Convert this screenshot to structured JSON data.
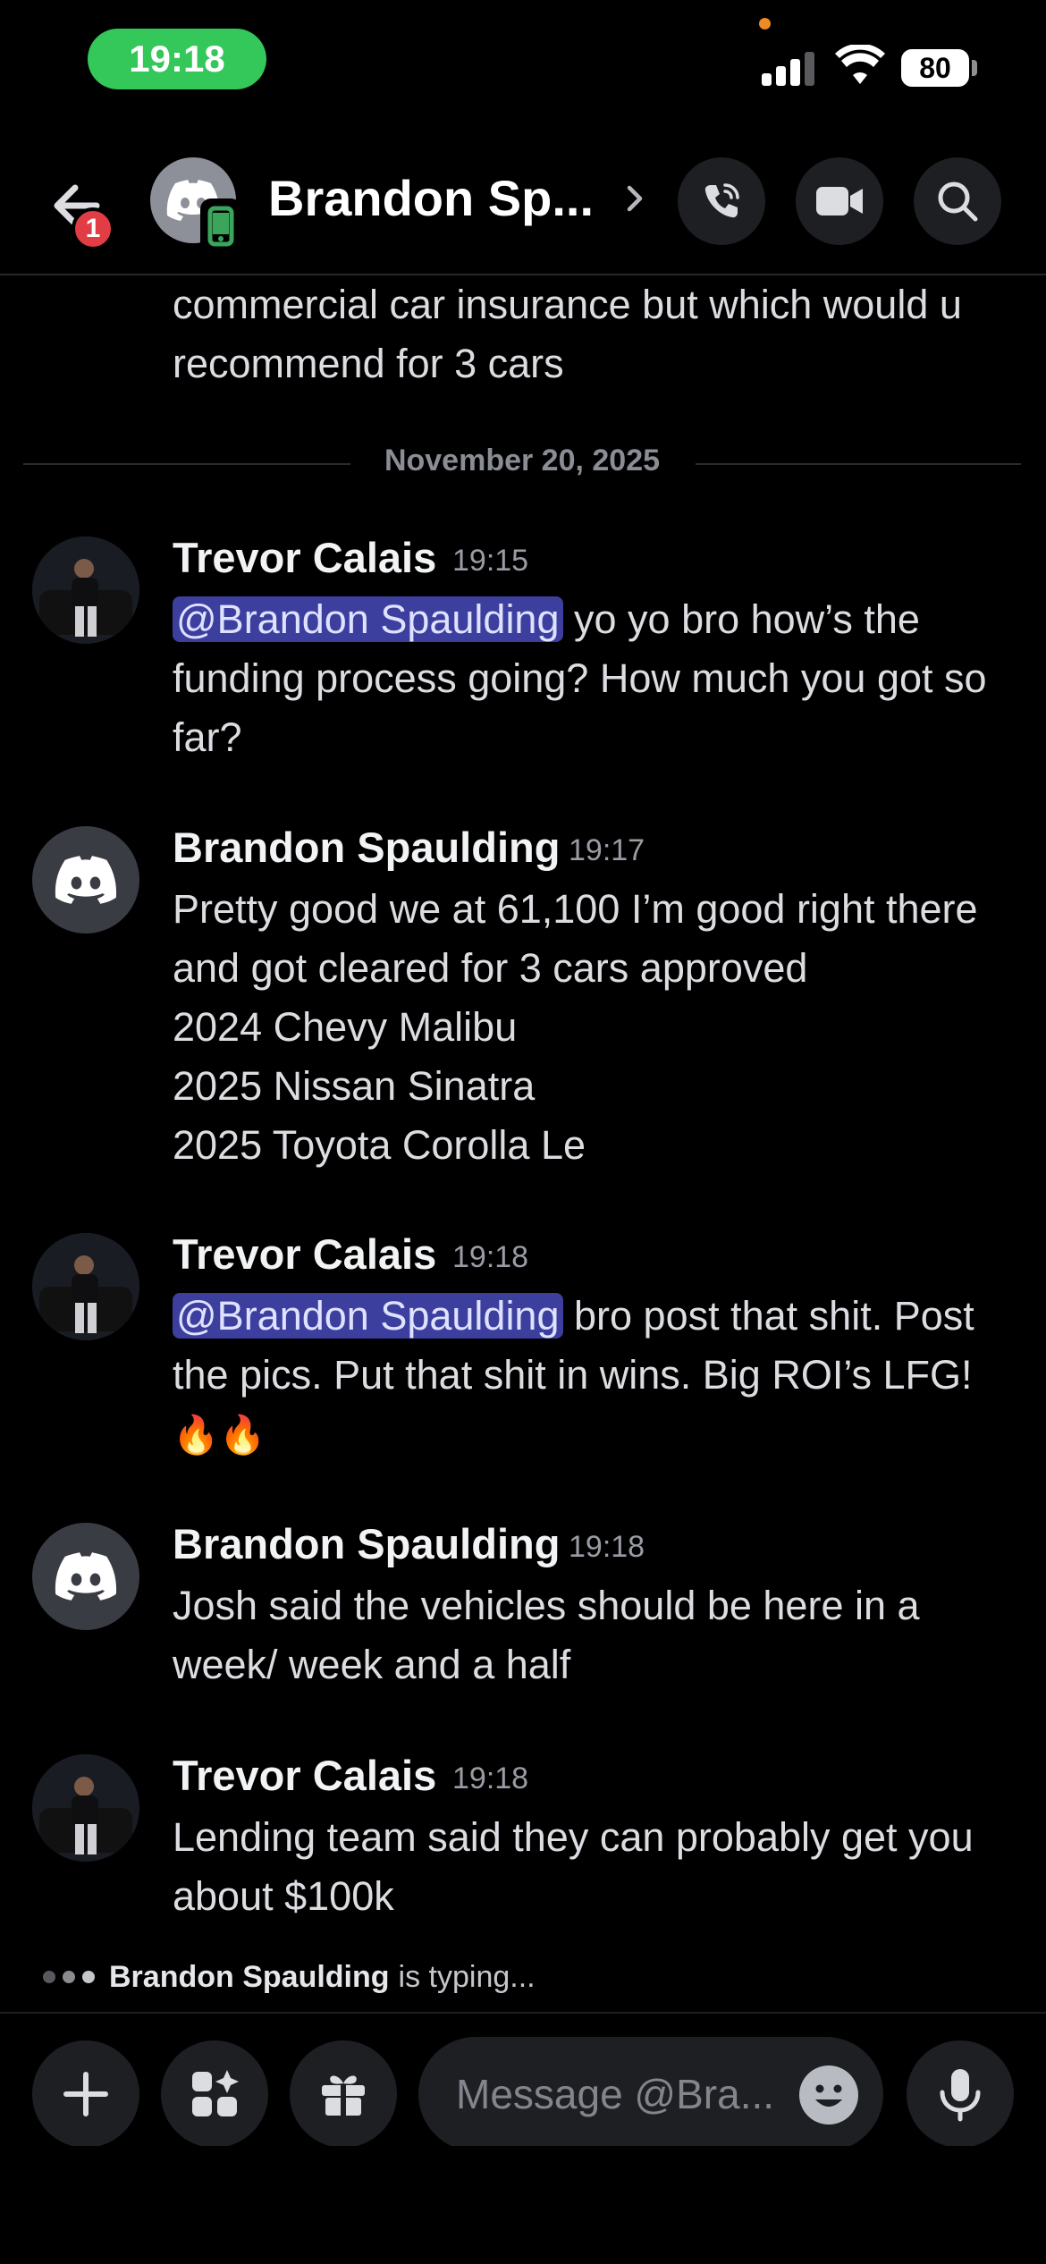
{
  "status_bar": {
    "time": "19:18",
    "battery": "80"
  },
  "header": {
    "title": "Brandon Sp...",
    "back_badge": "1"
  },
  "previous_message": {
    "text": "commercial car insurance but which would u recommend for 3 cars"
  },
  "date_divider": "November 20, 2025",
  "messages": [
    {
      "author": "Trevor Calais",
      "time": "19:15",
      "mention": "@Brandon Spaulding",
      "text": "yo yo  bro how’s the funding process going? How much you got so far?"
    },
    {
      "author": "Brandon Spaulding",
      "time": "19:17",
      "lines": [
        "Pretty good we at 61,100 I’m good right there and got cleared for 3 cars approved",
        "2024 Chevy Malibu",
        "2025 Nissan Sinatra",
        "2025 Toyota Corolla Le"
      ]
    },
    {
      "author": "Trevor Calais",
      "time": "19:18",
      "mention": "@Brandon Spaulding",
      "text": "bro post that shit. Post the pics. Put that shit in wins. Big ROI’s LFG!",
      "emoji": "🔥🔥"
    },
    {
      "author": "Brandon Spaulding",
      "time": "19:18",
      "text": "Josh said the vehicles should be here in a week/ week and a  half"
    },
    {
      "author": "Trevor Calais",
      "time": "19:18",
      "text": "Lending team said they can probably get you about $100k"
    }
  ],
  "typing": {
    "user": "Brandon Spaulding",
    "suffix": "is typing..."
  },
  "composer": {
    "placeholder": "Message @Bra..."
  },
  "colors": {
    "mention_bg": "#3c3f9e",
    "status_green": "#34c759",
    "badge_red": "#e23d44"
  },
  "icons": [
    "back-arrow-icon",
    "discord-icon",
    "mobile-icon",
    "chevron-right-icon",
    "phone-call-icon",
    "video-camera-icon",
    "search-icon",
    "plus-icon",
    "apps-icon",
    "gift-icon",
    "emoji-icon",
    "microphone-icon"
  ]
}
